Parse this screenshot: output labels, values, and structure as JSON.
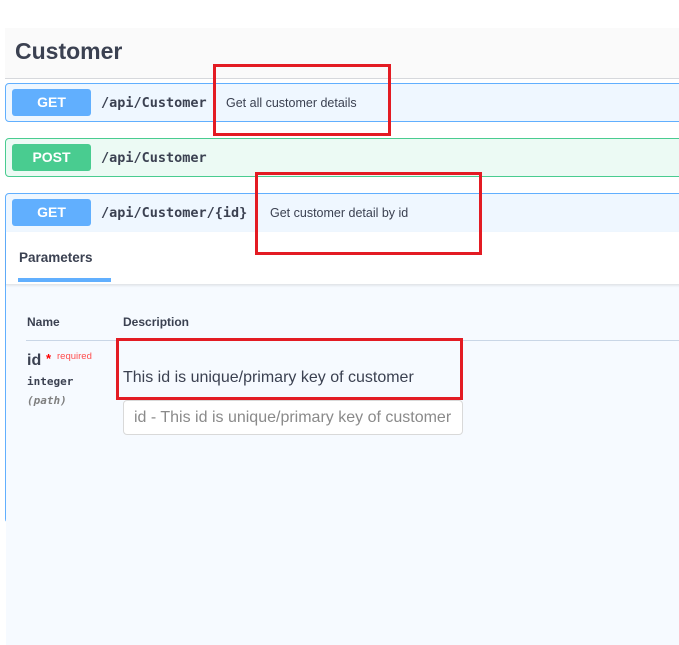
{
  "tag": {
    "title": "Customer"
  },
  "operations": [
    {
      "method": "GET",
      "path": "/api/Customer",
      "summary": "Get all customer details"
    },
    {
      "method": "POST",
      "path": "/api/Customer",
      "summary": ""
    },
    {
      "method": "GET",
      "path": "/api/Customer/{id}",
      "summary": "Get customer detail by id"
    }
  ],
  "parameters": {
    "tab_label": "Parameters",
    "columns": {
      "name": "Name",
      "description": "Description"
    },
    "items": [
      {
        "name": "id",
        "required_star": "*",
        "required_label": "required",
        "type": "integer",
        "in": "(path)",
        "description": "This id is unique/primary key of customer",
        "input_placeholder": "id - This id is unique/primary key of customer",
        "input_value": ""
      }
    ]
  },
  "colors": {
    "get": "#61affe",
    "post": "#49cc90",
    "highlight": "#e31b23"
  }
}
